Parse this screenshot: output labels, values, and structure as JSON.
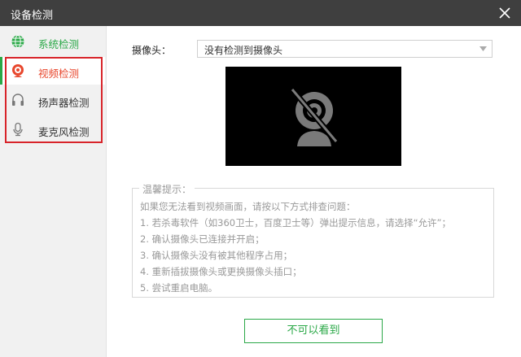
{
  "window": {
    "title": "设备检测",
    "close_icon": "close-icon"
  },
  "sidebar": {
    "items": [
      {
        "label": "系统检测",
        "icon": "globe-icon",
        "color": "#2aa847"
      },
      {
        "label": "视频检测",
        "icon": "webcam-icon",
        "active": true,
        "color": "#e8472d"
      },
      {
        "label": "扬声器检测",
        "icon": "headphones-icon"
      },
      {
        "label": "麦克风检测",
        "icon": "microphone-icon"
      }
    ],
    "highlight_color": "#d8242a"
  },
  "camera": {
    "label": "摄像头：",
    "selected": "没有检测到摄像头",
    "preview_icon": "webcam-disabled-icon"
  },
  "tips": {
    "title": "温馨提示：",
    "lines": [
      "如果您无法看到视频画面，请按以下方式排查问题：",
      "1. 若杀毒软件（如360卫士，百度卫士等）弹出提示信息，请选择“允许”；",
      "2. 确认摄像头已连接并开启；",
      "3. 确认摄像头没有被其他程序占用；",
      "4. 重新插拔摄像头或更换摄像头插口；",
      "5. 尝试重启电脑。"
    ]
  },
  "actions": {
    "confirm_label": "不可以看到"
  },
  "colors": {
    "accent": "#2aa847",
    "titlebar": "#3f3f3f",
    "sidebar_bg": "#f1f1f1"
  }
}
